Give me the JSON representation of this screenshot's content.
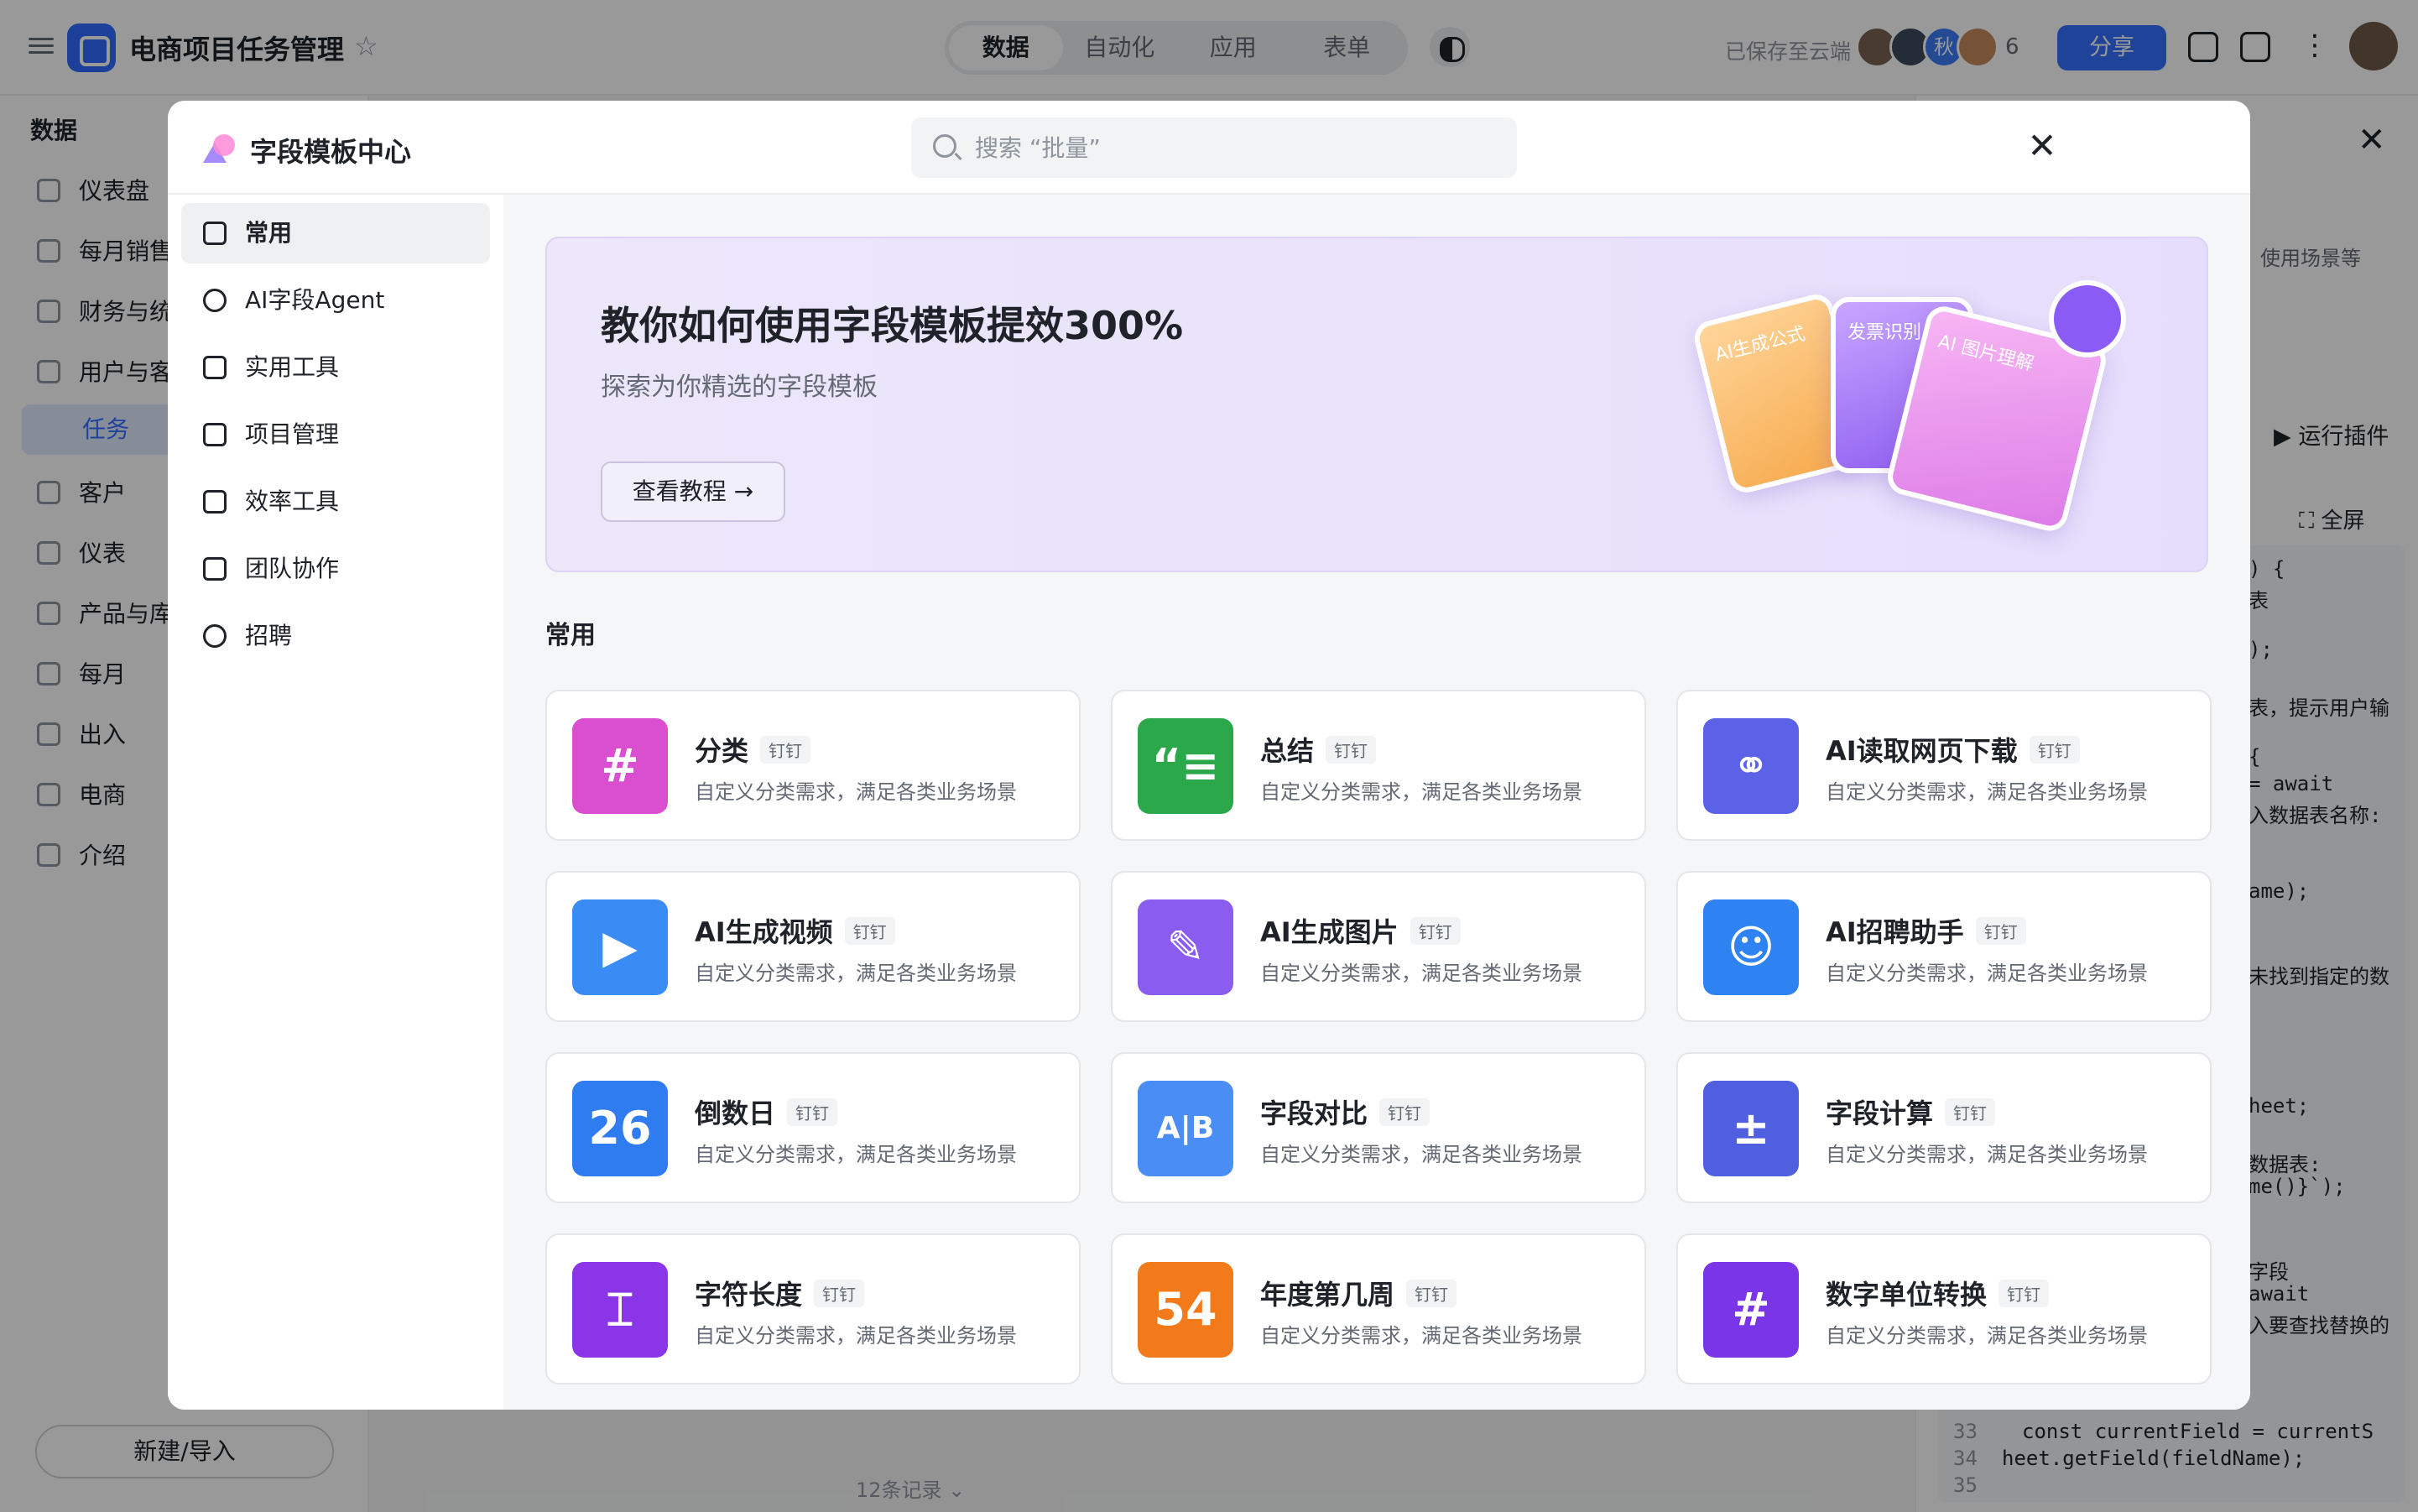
{
  "app": {
    "title": "电商项目任务管理",
    "view_tabs": [
      "数据",
      "自动化",
      "应用",
      "表单"
    ],
    "saved_status": "已保存至云端",
    "avatar_initial": "秋",
    "collaborator_count": "6",
    "share_label": "分享"
  },
  "left_nav": {
    "heading": "数据",
    "items": [
      "仪表盘",
      "每月销售",
      "财务与统",
      "用户与客",
      "任务",
      "客户",
      "仪表",
      "产品与库",
      "每月",
      "出入",
      "电商",
      "介绍"
    ],
    "new_import": "新建/导入"
  },
  "right_panel": {
    "snippets": [
      "使用场景等",
      "运行插件",
      "全屏"
    ],
    "code_lines": [
      ") {",
      "表",
      ");",
      "表，提示用户输",
      "{",
      "= await",
      "入数据表名称:",
      "ame);",
      "未找到指定的数",
      "heet;",
      "数据表:",
      "me()}`);",
      "字段",
      "await",
      "入要查找替换的"
    ],
    "code_tail": [
      {
        "num": "33",
        "text": "const currentField = currentS"
      },
      {
        "num": "34",
        "text": "heet.getField(fieldName);"
      },
      {
        "num": "35",
        "text": ""
      }
    ],
    "records": "12条记录"
  },
  "modal": {
    "title": "字段模板中心",
    "search_placeholder": "搜索 “批量”",
    "sidebar": [
      "常用",
      "AI字段Agent",
      "实用工具",
      "项目管理",
      "效率工具",
      "团队协作",
      "招聘"
    ],
    "banner": {
      "title": "教你如何使用字段模板提效300%",
      "subtitle": "探索为你精选的字段模板",
      "button": "查看教程",
      "card_labels": [
        "AI生成公式",
        "发票识别",
        "AI 图片理解"
      ]
    },
    "section_title": "常用",
    "cards": [
      {
        "name": "分类",
        "tag": "钉钉",
        "desc": "自定义分类需求，满足各类业务场景",
        "icon": "hashtag-sparkle-icon",
        "glyph": "#",
        "color": "#d94fd0"
      },
      {
        "name": "总结",
        "tag": "钉钉",
        "desc": "自定义分类需求，满足各类业务场景",
        "icon": "quote-lines-icon",
        "glyph": "“≡",
        "color": "#2aa84a"
      },
      {
        "name": "AI读取网页下载",
        "tag": "钉钉",
        "desc": "自定义分类需求，满足各类业务场景",
        "icon": "link-sparkle-icon",
        "glyph": "⚭",
        "color": "#5b62e8"
      },
      {
        "name": "AI生成视频",
        "tag": "钉钉",
        "desc": "自定义分类需求，满足各类业务场景",
        "icon": "video-play-icon",
        "glyph": "▶",
        "color": "#3a8cf5"
      },
      {
        "name": "AI生成图片",
        "tag": "钉钉",
        "desc": "自定义分类需求，满足各类业务场景",
        "icon": "brush-icon",
        "glyph": "✎",
        "color": "#8b5cf0"
      },
      {
        "name": "AI招聘助手",
        "tag": "钉钉",
        "desc": "自定义分类需求，满足各类业务场景",
        "icon": "resume-icon",
        "glyph": "☺",
        "color": "#2f82f2"
      },
      {
        "name": "倒数日",
        "tag": "钉钉",
        "desc": "自定义分类需求，满足各类业务场景",
        "icon": "countdown-calendar-icon",
        "glyph": "26",
        "color": "#2f7cf0"
      },
      {
        "name": "字段对比",
        "tag": "钉钉",
        "desc": "自定义分类需求，满足各类业务场景",
        "icon": "compare-ab-icon",
        "glyph": "A|B",
        "color": "#4a8df5"
      },
      {
        "name": "字段计算",
        "tag": "钉钉",
        "desc": "自定义分类需求，满足各类业务场景",
        "icon": "calculator-icon",
        "glyph": "±",
        "color": "#4f5fe0"
      },
      {
        "name": "字符长度",
        "tag": "钉钉",
        "desc": "自定义分类需求，满足各类业务场景",
        "icon": "text-cursor-icon",
        "glyph": "⌶",
        "color": "#8a35e8"
      },
      {
        "name": "年度第几周",
        "tag": "钉钉",
        "desc": "自定义分类需求，满足各类业务场景",
        "icon": "week-calendar-icon",
        "glyph": "54",
        "color": "#f27a1a"
      },
      {
        "name": "数字单位转换",
        "tag": "钉钉",
        "desc": "自定义分类需求，满足各类业务场景",
        "icon": "refresh-hash-icon",
        "glyph": "#",
        "color": "#7b35e8"
      }
    ]
  }
}
